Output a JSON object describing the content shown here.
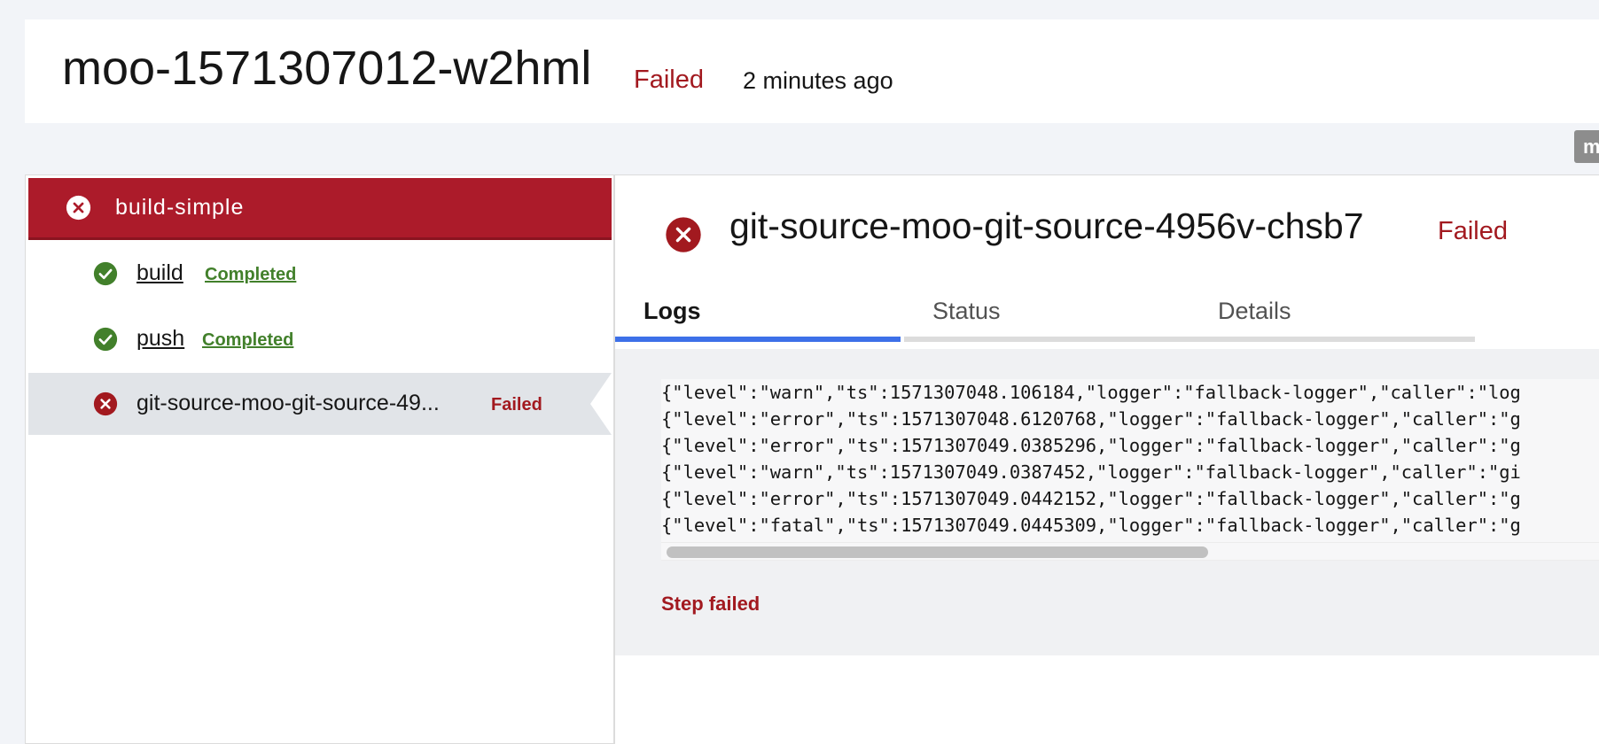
{
  "header": {
    "title": "moo-1571307012-w2hml",
    "status": "Failed",
    "time": "2 minutes ago"
  },
  "corner_chip": "m",
  "sidebar": {
    "task": {
      "label": "build-simple",
      "icon": "error-icon"
    },
    "steps": [
      {
        "name": "build",
        "status": "Completed",
        "icon": "checkmark-icon"
      },
      {
        "name": "push",
        "status": "Completed",
        "icon": "checkmark-icon"
      },
      {
        "name": "git-source-moo-git-source-49...",
        "status": "Failed",
        "icon": "error-icon"
      }
    ]
  },
  "detail": {
    "title": "git-source-moo-git-source-4956v-chsb7",
    "status": "Failed",
    "tabs": [
      {
        "label": "Logs",
        "active": true
      },
      {
        "label": "Status",
        "active": false
      },
      {
        "label": "Details",
        "active": false
      }
    ],
    "log_lines": [
      "{\"level\":\"warn\",\"ts\":1571307048.106184,\"logger\":\"fallback-logger\",\"caller\":\"log",
      "{\"level\":\"error\",\"ts\":1571307048.6120768,\"logger\":\"fallback-logger\",\"caller\":\"g",
      "{\"level\":\"error\",\"ts\":1571307049.0385296,\"logger\":\"fallback-logger\",\"caller\":\"g",
      "{\"level\":\"warn\",\"ts\":1571307049.0387452,\"logger\":\"fallback-logger\",\"caller\":\"gi",
      "{\"level\":\"error\",\"ts\":1571307049.0442152,\"logger\":\"fallback-logger\",\"caller\":\"g",
      "{\"level\":\"fatal\",\"ts\":1571307049.0445309,\"logger\":\"fallback-logger\",\"caller\":\"g"
    ],
    "step_message": "Step failed"
  },
  "colors": {
    "failed": "#a2191f",
    "task_banner": "#ac1b2a",
    "completed": "#42802b",
    "active_tab": "#3d70e8"
  }
}
